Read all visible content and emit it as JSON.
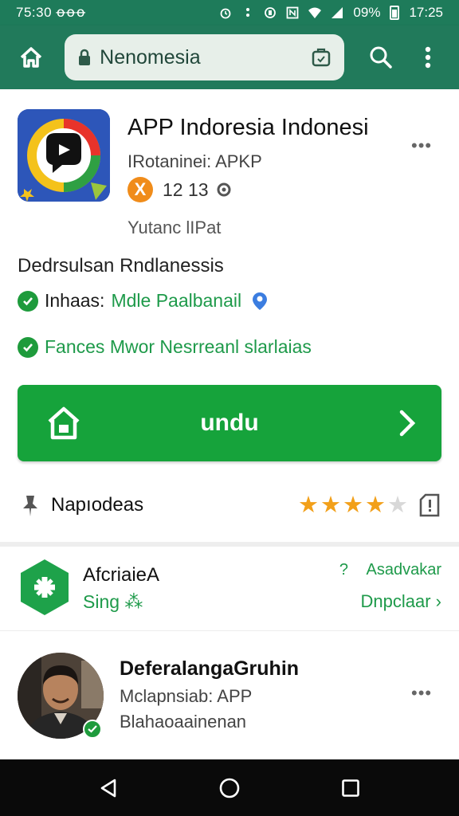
{
  "status_bar": {
    "time_left": "75:30 ꝋꝋꝋ",
    "battery_pct": "09%",
    "time_right": "17:25"
  },
  "app_bar": {
    "url": "Nenomesia",
    "icons": [
      "home-icon",
      "lock-icon",
      "tab-switcher-icon",
      "search-icon",
      "overflow-menu-icon"
    ]
  },
  "app": {
    "title": "APP Indoresia Indonesi",
    "developer": "IRotaninei: APKP",
    "rating_badge": "X",
    "rating_count": "12 13",
    "sub": "Yutanc lIPat",
    "description": "Dedrsulsan Rndlanessis",
    "features": [
      {
        "label": "Inhaas:",
        "link": "Mdle Paalbanail"
      },
      {
        "label": "Fances Mwor Nesrreanl slarlaias"
      }
    ],
    "download_label": "undu",
    "review_label": "Napıodeas",
    "stars": 4,
    "stars_total": 5
  },
  "item2": {
    "title": "AfcriaieA",
    "sub": "Sing ⁂",
    "right_q": "?",
    "right_link": "Asadvakar",
    "right_action": "Dnpclaar ›"
  },
  "item3": {
    "title": "DeferalangaGruhin",
    "line1": "Mclapnsiab: APP",
    "line2": "Blahaoaainenan"
  },
  "more_icon": "•••",
  "colors": {
    "app_bar": "#217a5b",
    "status_bar": "#1e7b5a",
    "primary_green": "#16a33b",
    "link_green": "#1e9a4a",
    "star": "#f2a01a",
    "badge_orange": "#f08c1a"
  }
}
